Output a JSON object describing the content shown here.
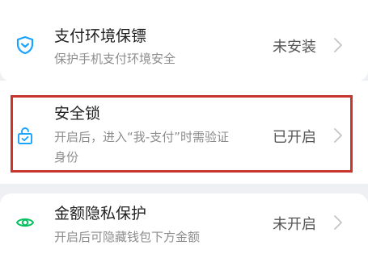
{
  "settings": {
    "items": [
      {
        "title": "支付环境保镖",
        "description": "保护手机支付环境安全",
        "status": "未安装",
        "icon": "shield-icon"
      },
      {
        "title": "安全锁",
        "description_line1": "开启后，进入“我-支付”时需验证",
        "description_line2": "身份",
        "status": "已开启",
        "icon": "lock-icon"
      },
      {
        "title": "金额隐私保护",
        "description": "开启后可隐藏钱包下方金额",
        "status": "未开启",
        "icon": "eye-icon"
      }
    ]
  },
  "colors": {
    "accent": "#07c160",
    "highlight": "#c8352e",
    "background": "#eef0f3"
  }
}
